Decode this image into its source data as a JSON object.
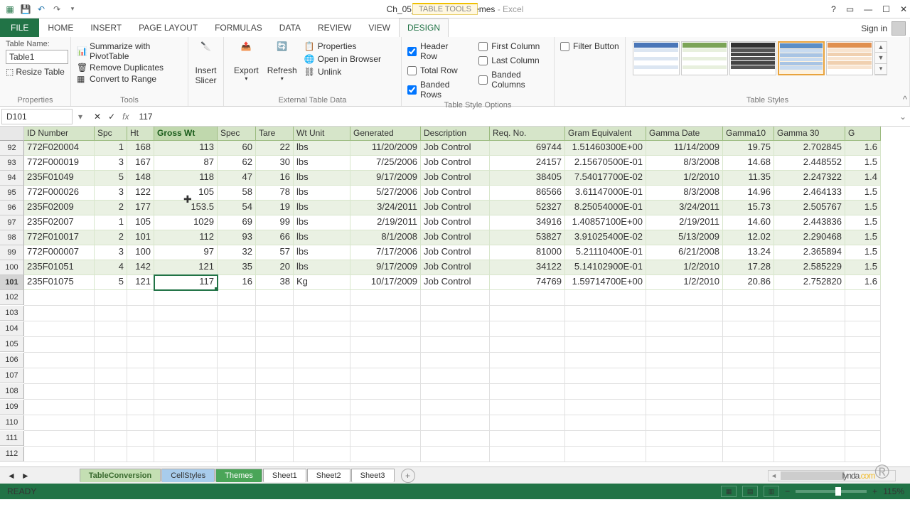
{
  "title": {
    "file": "Ch_05_TablesStylesThemes",
    "suffix": " - Excel"
  },
  "table_tools": "TABLE TOOLS",
  "tabs": {
    "file": "FILE",
    "home": "HOME",
    "insert": "INSERT",
    "page": "PAGE LAYOUT",
    "formulas": "FORMULAS",
    "data": "DATA",
    "review": "REVIEW",
    "view": "VIEW",
    "design": "DESIGN"
  },
  "signin": "Sign in",
  "ribbon": {
    "table_name_label": "Table Name:",
    "table_name": "Table1",
    "resize": "Resize Table",
    "properties_label": "Properties",
    "summarize": "Summarize with PivotTable",
    "remove_dup": "Remove Duplicates",
    "convert": "Convert to Range",
    "tools_label": "Tools",
    "insert_slicer": "Insert\nSlicer",
    "export": "Export",
    "refresh": "Refresh",
    "props": "Properties",
    "open_browser": "Open in Browser",
    "unlink": "Unlink",
    "ext_label": "External Table Data",
    "header_row": "Header Row",
    "total_row": "Total Row",
    "banded_rows": "Banded Rows",
    "first_col": "First Column",
    "last_col": "Last Column",
    "banded_cols": "Banded Columns",
    "filter_btn": "Filter Button",
    "opts_label": "Table Style Options",
    "styles_label": "Table Styles"
  },
  "namebox": "D101",
  "formula": "117",
  "headers": [
    "ID Number",
    "Spc",
    "Ht",
    "Gross Wt",
    "Spec",
    "Tare",
    "Wt Unit",
    "Generated",
    "Description",
    "Req. No.",
    "Gram Equivalent",
    "Gamma Date",
    "Gamma10",
    "Gamma 30",
    "G"
  ],
  "row_start": 92,
  "rows": [
    [
      "772F020004",
      "1",
      "168",
      "113",
      "60",
      "22",
      "lbs",
      "11/20/2009",
      "Job Control",
      "69744",
      "1.51460300E+00",
      "11/14/2009",
      "19.75",
      "2.702845",
      "1.6"
    ],
    [
      "772F000019",
      "3",
      "167",
      "87",
      "62",
      "30",
      "lbs",
      "7/25/2006",
      "Job Control",
      "24157",
      "2.15670500E-01",
      "8/3/2008",
      "14.68",
      "2.448552",
      "1.5"
    ],
    [
      "235F01049",
      "5",
      "148",
      "118",
      "47",
      "16",
      "lbs",
      "9/17/2009",
      "Job Control",
      "38405",
      "7.54017700E-02",
      "1/2/2010",
      "11.35",
      "2.247322",
      "1.4"
    ],
    [
      "772F000026",
      "3",
      "122",
      "105",
      "58",
      "78",
      "lbs",
      "5/27/2006",
      "Job Control",
      "86566",
      "3.61147000E-01",
      "8/3/2008",
      "14.96",
      "2.464133",
      "1.5"
    ],
    [
      "235F02009",
      "2",
      "177",
      "153.5",
      "54",
      "19",
      "lbs",
      "3/24/2011",
      "Job Control",
      "52327",
      "8.25054000E-01",
      "3/24/2011",
      "15.73",
      "2.505767",
      "1.5"
    ],
    [
      "235F02007",
      "1",
      "105",
      "1029",
      "69",
      "99",
      "lbs",
      "2/19/2011",
      "Job Control",
      "34916",
      "1.40857100E+00",
      "2/19/2011",
      "14.60",
      "2.443836",
      "1.5"
    ],
    [
      "772F010017",
      "2",
      "101",
      "112",
      "93",
      "66",
      "lbs",
      "8/1/2008",
      "Job Control",
      "53827",
      "3.91025400E-02",
      "5/13/2009",
      "12.02",
      "2.290468",
      "1.5"
    ],
    [
      "772F000007",
      "3",
      "100",
      "97",
      "32",
      "57",
      "lbs",
      "7/17/2006",
      "Job Control",
      "81000",
      "5.21110400E-01",
      "6/21/2008",
      "13.24",
      "2.365894",
      "1.5"
    ],
    [
      "235F01051",
      "4",
      "142",
      "121",
      "35",
      "20",
      "lbs",
      "9/17/2009",
      "Job Control",
      "34122",
      "5.14102900E-01",
      "1/2/2010",
      "17.28",
      "2.585229",
      "1.5"
    ],
    [
      "235F01075",
      "5",
      "121",
      "117",
      "16",
      "38",
      "Kg",
      "10/17/2009",
      "Job Control",
      "74769",
      "1.59714700E+00",
      "1/2/2010",
      "20.86",
      "2.752820",
      "1.6"
    ]
  ],
  "empty_rows": [
    102,
    103,
    104,
    105,
    106,
    107,
    108,
    109,
    110,
    111,
    112
  ],
  "sheet_tabs": {
    "t1": "TableConversion",
    "t2": "CellStyles",
    "t3": "Themes",
    "t4": "Sheet1",
    "t5": "Sheet2",
    "t6": "Sheet3"
  },
  "status": {
    "ready": "READY",
    "zoom": "115%"
  },
  "watermark": {
    "a": "lynda",
    "b": ".com"
  },
  "active": {
    "row": 101,
    "col": 3
  }
}
